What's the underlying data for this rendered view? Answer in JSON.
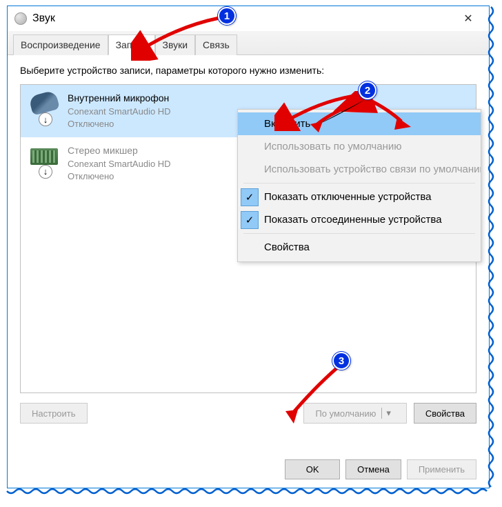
{
  "window": {
    "title": "Звук"
  },
  "tabs": [
    {
      "label": "Воспроизведение"
    },
    {
      "label": "Запись"
    },
    {
      "label": "Звуки"
    },
    {
      "label": "Связь"
    }
  ],
  "instruction": "Выберите устройство записи, параметры которого нужно изменить:",
  "devices": [
    {
      "name": "Внутренний микрофон",
      "driver": "Conexant SmartAudio HD",
      "status": "Отключено"
    },
    {
      "name": "Стерео микшер",
      "driver": "Conexant SmartAudio HD",
      "status": "Отключено"
    }
  ],
  "context_menu": {
    "enable": "Включить",
    "default": "Использовать по умолчанию",
    "comm_default": "Использовать устройство связи по умолчанию",
    "show_disabled": "Показать отключенные устройства",
    "show_disconnected": "Показать отсоединенные устройства",
    "properties": "Свойства"
  },
  "buttons": {
    "configure": "Настроить",
    "set_default": "По умолчанию",
    "properties": "Свойства",
    "ok": "OK",
    "cancel": "Отмена",
    "apply": "Применить"
  },
  "annotations": {
    "b1": "1",
    "b2": "2",
    "b3": "3"
  }
}
